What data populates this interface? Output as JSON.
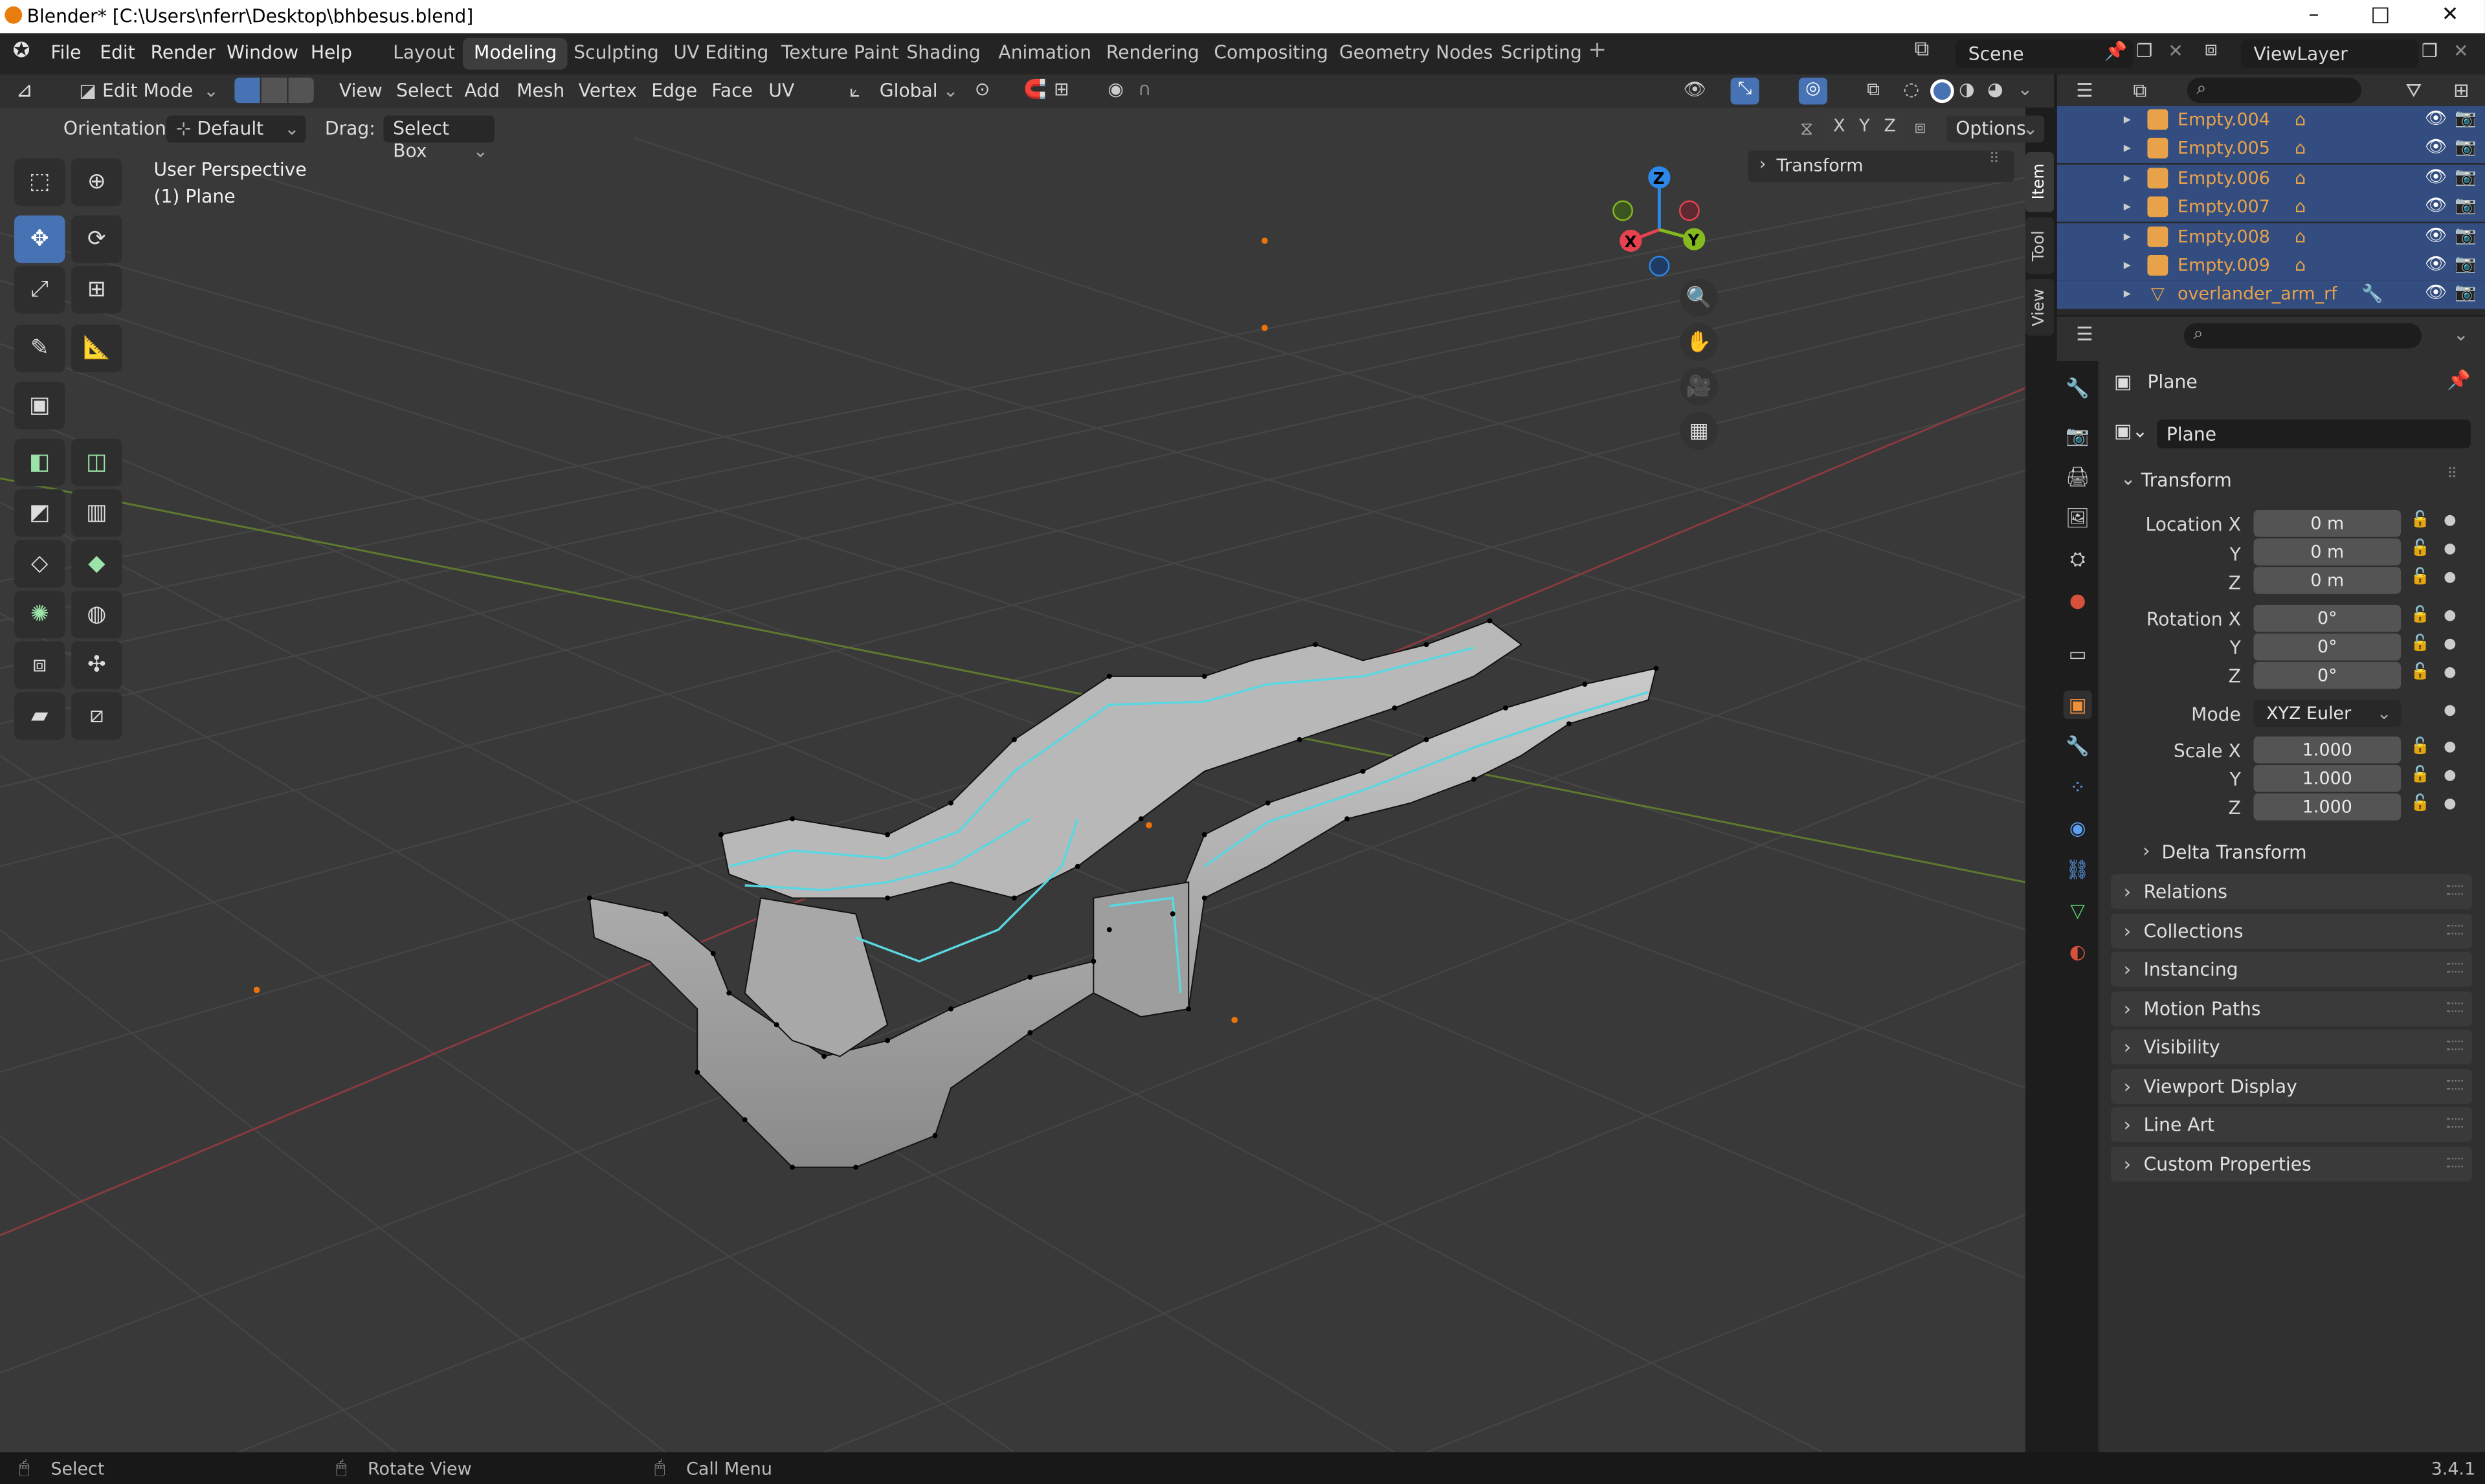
{
  "window": {
    "title": "Blender* [C:\\Users\\nferr\\Desktop\\bhbesus.blend]"
  },
  "menu": {
    "file": "File",
    "edit": "Edit",
    "render": "Render",
    "window": "Window",
    "help": "Help"
  },
  "workspaces": [
    "Layout",
    "Modeling",
    "Sculpting",
    "UV Editing",
    "Texture Paint",
    "Shading",
    "Animation",
    "Rendering",
    "Compositing",
    "Geometry Nodes",
    "Scripting"
  ],
  "active_workspace": "Modeling",
  "scene": {
    "name": "Scene",
    "view_layer": "ViewLayer"
  },
  "viewport_header": {
    "mode": "Edit Mode",
    "view": "View",
    "select": "Select",
    "add": "Add",
    "mesh": "Mesh",
    "vertex": "Vertex",
    "edge": "Edge",
    "face": "Face",
    "uv": "UV",
    "transform_orientation": "Global",
    "orientation_label": "Orientation:",
    "orientation_value": "Default",
    "drag_label": "Drag:",
    "drag_value": "Select Box",
    "axis_x": "X",
    "axis_y": "Y",
    "axis_z": "Z",
    "options": "Options"
  },
  "viewport": {
    "perspective": "User Perspective",
    "object": "(1) Plane",
    "npanel_transform": "Transform"
  },
  "npanel_tabs": [
    "Item",
    "Tool",
    "View"
  ],
  "gizmo": {
    "x": "X",
    "y": "Y",
    "z": "Z",
    "colors": {
      "x": "#e6424f",
      "y": "#84ba1e",
      "z": "#2c88e8"
    }
  },
  "outliner": {
    "items": [
      {
        "name": "Empty.004",
        "type": "empty"
      },
      {
        "name": "Empty.005",
        "type": "empty"
      },
      {
        "name": "Empty.006",
        "type": "empty"
      },
      {
        "name": "Empty.007",
        "type": "empty"
      },
      {
        "name": "Empty.008",
        "type": "empty"
      },
      {
        "name": "Empty.009",
        "type": "empty"
      },
      {
        "name": "overlander_arm_rf",
        "type": "mesh"
      }
    ]
  },
  "properties": {
    "object_name": "Plane",
    "name_field": "Plane",
    "transform": {
      "title": "Transform",
      "location_label": "Location X",
      "location": [
        "0 m",
        "0 m",
        "0 m"
      ],
      "rotation_label": "Rotation X",
      "rotation": [
        "0°",
        "0°",
        "0°"
      ],
      "mode_label": "Mode",
      "mode": "XYZ Euler",
      "scale_label": "Scale X",
      "scale": [
        "1.000",
        "1.000",
        "1.000"
      ],
      "y": "Y",
      "z": "Z",
      "delta": "Delta Transform"
    },
    "panels": [
      "Relations",
      "Collections",
      "Instancing",
      "Motion Paths",
      "Visibility",
      "Viewport Display",
      "Line Art",
      "Custom Properties"
    ]
  },
  "status": {
    "select": "Select",
    "rotate": "Rotate View",
    "menu": "Call Menu",
    "version": "3.4.1"
  },
  "colors": {
    "accent": "#4772b3",
    "selected_edge": "#5ad7e0",
    "outliner_sel": "#334d80",
    "name_orange": "#e8a24a"
  }
}
